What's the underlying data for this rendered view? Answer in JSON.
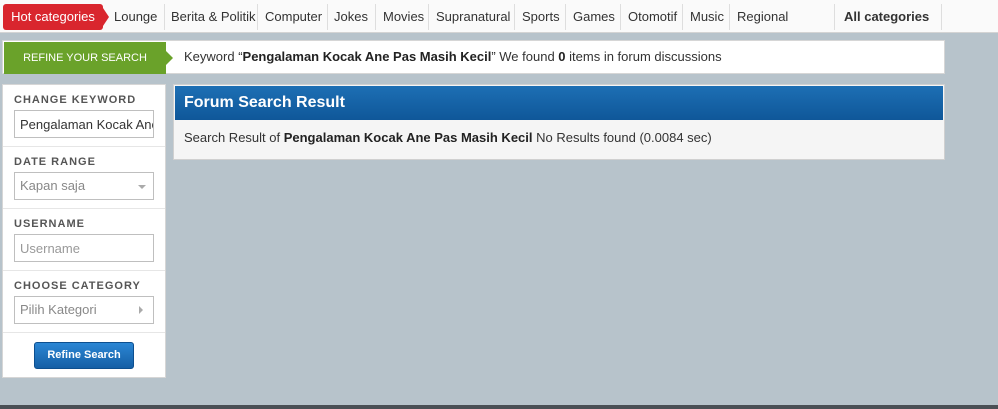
{
  "nav": {
    "hot": "Hot categories",
    "items": [
      "Lounge",
      "Berita & Politik",
      "Computer",
      "Jokes",
      "Movies",
      "Supranatural",
      "Sports",
      "Games",
      "Otomotif",
      "Music",
      "Regional"
    ],
    "all_categories": "All categories"
  },
  "refine": {
    "tab_label": "REFINE YOUR SEARCH",
    "keyword_prefix": "Keyword “",
    "keyword": "Pengalaman Kocak Ane Pas Masih Kecil",
    "keyword_suffix": "” We found ",
    "count": "0",
    "count_suffix": " items in forum discussions"
  },
  "sidebar": {
    "change_keyword_label": "CHANGE KEYWORD",
    "keyword_value": "Pengalaman Kocak Ane Pas Masih Kecil",
    "date_range_label": "DATE RANGE",
    "date_range_value": "Kapan saja",
    "username_label": "USERNAME",
    "username_placeholder": "Username",
    "category_label": "CHOOSE CATEGORY",
    "category_value": "Pilih Kategori",
    "refine_button": "Refine Search"
  },
  "result": {
    "title": "Forum Search Result",
    "prefix": "Search Result of ",
    "keyword": "Pengalaman Kocak Ane Pas Masih Kecil",
    "suffix": " No Results found (0.0084 sec)"
  },
  "colors": {
    "hot_red": "#d9262e",
    "refine_green": "#6aa22a",
    "header_blue": "#0f5799",
    "background": "#b7c3cb"
  }
}
